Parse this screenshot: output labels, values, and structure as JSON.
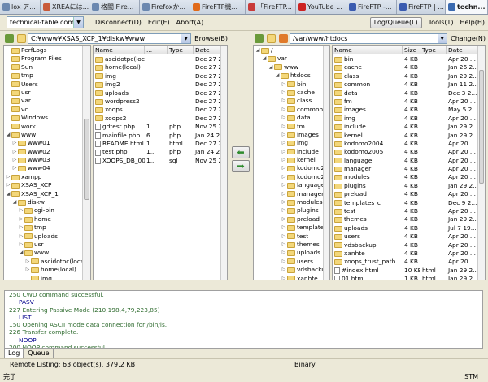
{
  "tabs": [
    {
      "label": "lox ア...",
      "color": "#6b88b0"
    },
    {
      "label": "XREAには...",
      "color": "#c85a3a"
    },
    {
      "label": "格闘 Fire...",
      "color": "#6b88b0"
    },
    {
      "label": "Firefoxか...",
      "color": "#6b88b0"
    },
    {
      "label": "FireFTP機...",
      "color": "#e06a1a"
    },
    {
      "label": "「FireFTP...",
      "color": "#c83a3a"
    },
    {
      "label": "YouTube ...",
      "color": "#cc2222"
    },
    {
      "label": "FireFTP -...",
      "color": "#3a5bb0"
    },
    {
      "label": "FireFTP | ...",
      "color": "#3a5bb0"
    },
    {
      "label": "techn...",
      "color": "#3a6ab0"
    }
  ],
  "toolbar": {
    "account": "technical-table.com",
    "disconnect": "Disconnect(D)",
    "edit": "Edit(E)",
    "abort": "Abort(A)",
    "log_queue": "Log/Queue(L)",
    "tools": "Tools(T)",
    "help": "Help(H)"
  },
  "local": {
    "path": "C:¥www¥XSAS_XCP_1¥diskw¥www",
    "browse": "Browse(B)",
    "tree": [
      {
        "indent": 0,
        "tw": "",
        "label": "PerfLogs"
      },
      {
        "indent": 0,
        "tw": "",
        "label": "Program Files"
      },
      {
        "indent": 0,
        "tw": "",
        "label": "Sun"
      },
      {
        "indent": 0,
        "tw": "",
        "label": "tmp"
      },
      {
        "indent": 0,
        "tw": "",
        "label": "Users"
      },
      {
        "indent": 0,
        "tw": "",
        "label": "usr"
      },
      {
        "indent": 0,
        "tw": "",
        "label": "var"
      },
      {
        "indent": 0,
        "tw": "",
        "label": "vc"
      },
      {
        "indent": 0,
        "tw": "",
        "label": "Windows"
      },
      {
        "indent": 0,
        "tw": "",
        "label": "work"
      },
      {
        "indent": 0,
        "tw": "◢",
        "label": "www"
      },
      {
        "indent": 1,
        "tw": "▷",
        "label": "www01"
      },
      {
        "indent": 1,
        "tw": "▷",
        "label": "www02"
      },
      {
        "indent": 1,
        "tw": "▷",
        "label": "www03"
      },
      {
        "indent": 1,
        "tw": "▷",
        "label": "www04"
      },
      {
        "indent": 0,
        "tw": "▷",
        "label": "xampp"
      },
      {
        "indent": 0,
        "tw": "▷",
        "label": "XSAS_XCP"
      },
      {
        "indent": 0,
        "tw": "◢",
        "label": "XSAS_XCP_1"
      },
      {
        "indent": 1,
        "tw": "◢",
        "label": "diskw"
      },
      {
        "indent": 2,
        "tw": "▷",
        "label": "cgi-bin"
      },
      {
        "indent": 2,
        "tw": "▷",
        "label": "home"
      },
      {
        "indent": 2,
        "tw": "▷",
        "label": "tmp"
      },
      {
        "indent": 2,
        "tw": "▷",
        "label": "uploads"
      },
      {
        "indent": 2,
        "tw": "▷",
        "label": "usr"
      },
      {
        "indent": 2,
        "tw": "◢",
        "label": "www"
      },
      {
        "indent": 3,
        "tw": "▷",
        "label": "ascidotpc(local)"
      },
      {
        "indent": 3,
        "tw": "▷",
        "label": "home(local)"
      },
      {
        "indent": 3,
        "tw": "",
        "label": "img"
      }
    ],
    "columns": [
      "Name",
      "...",
      "Type",
      "Date"
    ],
    "files": [
      {
        "name": "ascidotpc(local)",
        "size": "",
        "type": "",
        "date": "Dec 27 2...",
        "folder": true
      },
      {
        "name": "home(local)",
        "size": "",
        "type": "",
        "date": "Dec 27 2...",
        "folder": true
      },
      {
        "name": "img",
        "size": "",
        "type": "",
        "date": "Dec 27 2...",
        "folder": true
      },
      {
        "name": "img2",
        "size": "",
        "type": "",
        "date": "Dec 27 2...",
        "folder": true
      },
      {
        "name": "uploads",
        "size": "",
        "type": "",
        "date": "Dec 27 2...",
        "folder": true
      },
      {
        "name": "wordpress2",
        "size": "",
        "type": "",
        "date": "Dec 27 2...",
        "folder": true
      },
      {
        "name": "xoops",
        "size": "",
        "type": "",
        "date": "Dec 27 2...",
        "folder": true
      },
      {
        "name": "xoops2",
        "size": "",
        "type": "",
        "date": "Dec 27 2...",
        "folder": true
      },
      {
        "name": "gdtest.php",
        "size": "1...",
        "type": "php",
        "date": "Nov 25 2...",
        "folder": false
      },
      {
        "name": "mainfile.php",
        "size": "6...",
        "type": "php",
        "date": "Jan 24 2009",
        "folder": false
      },
      {
        "name": "README.html",
        "size": "1...",
        "type": "html",
        "date": "Dec 27 2...",
        "folder": false
      },
      {
        "name": "test.php",
        "size": "1...",
        "type": "php",
        "date": "Jan 24 2009",
        "folder": false
      },
      {
        "name": "XOOPS_DB_00...",
        "size": "1...",
        "type": "sql",
        "date": "Nov 25 2...",
        "folder": false
      }
    ]
  },
  "remote": {
    "path": "/var/www/htdocs",
    "change": "Change(N)",
    "tree": [
      {
        "indent": 0,
        "tw": "◢",
        "label": "/"
      },
      {
        "indent": 1,
        "tw": "◢",
        "label": "var"
      },
      {
        "indent": 2,
        "tw": "◢",
        "label": "www"
      },
      {
        "indent": 3,
        "tw": "◢",
        "label": "htdocs"
      },
      {
        "indent": 4,
        "tw": "▷",
        "label": "bin"
      },
      {
        "indent": 4,
        "tw": "▷",
        "label": "cache"
      },
      {
        "indent": 4,
        "tw": "▷",
        "label": "class"
      },
      {
        "indent": 4,
        "tw": "▷",
        "label": "common"
      },
      {
        "indent": 4,
        "tw": "▷",
        "label": "data"
      },
      {
        "indent": 4,
        "tw": "▷",
        "label": "fm"
      },
      {
        "indent": 4,
        "tw": "▷",
        "label": "images"
      },
      {
        "indent": 4,
        "tw": "▷",
        "label": "img"
      },
      {
        "indent": 4,
        "tw": "▷",
        "label": "include"
      },
      {
        "indent": 4,
        "tw": "▷",
        "label": "kernel"
      },
      {
        "indent": 4,
        "tw": "▷",
        "label": "kodomo2004"
      },
      {
        "indent": 4,
        "tw": "▷",
        "label": "kodomo2005"
      },
      {
        "indent": 4,
        "tw": "▷",
        "label": "language"
      },
      {
        "indent": 4,
        "tw": "▷",
        "label": "manager"
      },
      {
        "indent": 4,
        "tw": "▷",
        "label": "modules"
      },
      {
        "indent": 4,
        "tw": "▷",
        "label": "plugins"
      },
      {
        "indent": 4,
        "tw": "▷",
        "label": "preload"
      },
      {
        "indent": 4,
        "tw": "▷",
        "label": "templates_c"
      },
      {
        "indent": 4,
        "tw": "▷",
        "label": "test"
      },
      {
        "indent": 4,
        "tw": "▷",
        "label": "themes"
      },
      {
        "indent": 4,
        "tw": "▷",
        "label": "uploads"
      },
      {
        "indent": 4,
        "tw": "▷",
        "label": "users"
      },
      {
        "indent": 4,
        "tw": "▷",
        "label": "vdsbackup"
      },
      {
        "indent": 4,
        "tw": "▷",
        "label": "xanhte"
      }
    ],
    "columns": [
      "Name",
      "Size",
      "Type",
      "Date"
    ],
    "files": [
      {
        "name": "bin",
        "size": "4 KB",
        "type": "",
        "date": "Apr 20 ...",
        "folder": true
      },
      {
        "name": "cache",
        "size": "4 KB",
        "type": "",
        "date": "Jan 26 2...",
        "folder": true
      },
      {
        "name": "class",
        "size": "4 KB",
        "type": "",
        "date": "Jan 29 2...",
        "folder": true
      },
      {
        "name": "common",
        "size": "4 KB",
        "type": "",
        "date": "Jan 11 2...",
        "folder": true
      },
      {
        "name": "data",
        "size": "4 KB",
        "type": "",
        "date": "Dec 3 2...",
        "folder": true
      },
      {
        "name": "fm",
        "size": "4 KB",
        "type": "",
        "date": "Apr 20 ...",
        "folder": true
      },
      {
        "name": "images",
        "size": "4 KB",
        "type": "",
        "date": "May 5 2...",
        "folder": true
      },
      {
        "name": "img",
        "size": "4 KB",
        "type": "",
        "date": "Apr 20 ...",
        "folder": true
      },
      {
        "name": "include",
        "size": "4 KB",
        "type": "",
        "date": "Jan 29 2...",
        "folder": true
      },
      {
        "name": "kernel",
        "size": "4 KB",
        "type": "",
        "date": "Jan 29 2...",
        "folder": true
      },
      {
        "name": "kodomo2004",
        "size": "4 KB",
        "type": "",
        "date": "Apr 20 ...",
        "folder": true
      },
      {
        "name": "kodomo2005",
        "size": "4 KB",
        "type": "",
        "date": "Apr 20 ...",
        "folder": true
      },
      {
        "name": "language",
        "size": "4 KB",
        "type": "",
        "date": "Apr 20 ...",
        "folder": true
      },
      {
        "name": "manager",
        "size": "4 KB",
        "type": "",
        "date": "Apr 20 ...",
        "folder": true
      },
      {
        "name": "modules",
        "size": "4 KB",
        "type": "",
        "date": "Apr 20 ...",
        "folder": true
      },
      {
        "name": "plugins",
        "size": "4 KB",
        "type": "",
        "date": "Jan 29 2...",
        "folder": true
      },
      {
        "name": "preload",
        "size": "4 KB",
        "type": "",
        "date": "Apr 20 ...",
        "folder": true
      },
      {
        "name": "templates_c",
        "size": "4 KB",
        "type": "",
        "date": "Dec 9 2...",
        "folder": true
      },
      {
        "name": "test",
        "size": "4 KB",
        "type": "",
        "date": "Apr 20 ...",
        "folder": true
      },
      {
        "name": "themes",
        "size": "4 KB",
        "type": "",
        "date": "Jan 29 2...",
        "folder": true
      },
      {
        "name": "uploads",
        "size": "4 KB",
        "type": "",
        "date": "Jul 7 19...",
        "folder": true
      },
      {
        "name": "users",
        "size": "4 KB",
        "type": "",
        "date": "Apr 20 ...",
        "folder": true
      },
      {
        "name": "vdsbackup",
        "size": "4 KB",
        "type": "",
        "date": "Apr 20 ...",
        "folder": true
      },
      {
        "name": "xanhte",
        "size": "4 KB",
        "type": "",
        "date": "Apr 20 ...",
        "folder": true
      },
      {
        "name": "xoops_trust_path",
        "size": "4 KB",
        "type": "",
        "date": "Apr 20 ...",
        "folder": true
      },
      {
        "name": "#index.html",
        "size": "10 KB",
        "type": "html",
        "date": "Jan 29 2...",
        "folder": false
      },
      {
        "name": "01.html",
        "size": "1 KB",
        "type": "html",
        "date": "Jan 29 2...",
        "folder": false
      }
    ]
  },
  "log": [
    {
      "kind": "resp",
      "text": "250 CWD command successful."
    },
    {
      "kind": "cmd",
      "text": "PASV"
    },
    {
      "kind": "resp",
      "text": "227 Entering Passive Mode (210,198,4,79,223,85)"
    },
    {
      "kind": "cmd",
      "text": "LIST"
    },
    {
      "kind": "resp",
      "text": "150 Opening ASCII mode data connection for /bin/ls."
    },
    {
      "kind": "resp",
      "text": "226 Transfer complete."
    },
    {
      "kind": "cmd",
      "text": "NOOP"
    },
    {
      "kind": "resp",
      "text": "200 NOOP command successful."
    }
  ],
  "bottom_tabs": {
    "log": "Log",
    "queue": "Queue"
  },
  "status": {
    "listing": "Remote Listing: 63 object(s), 379.2 KB",
    "mode": "Binary"
  },
  "bottom": {
    "left": "完了",
    "right": "STM"
  }
}
